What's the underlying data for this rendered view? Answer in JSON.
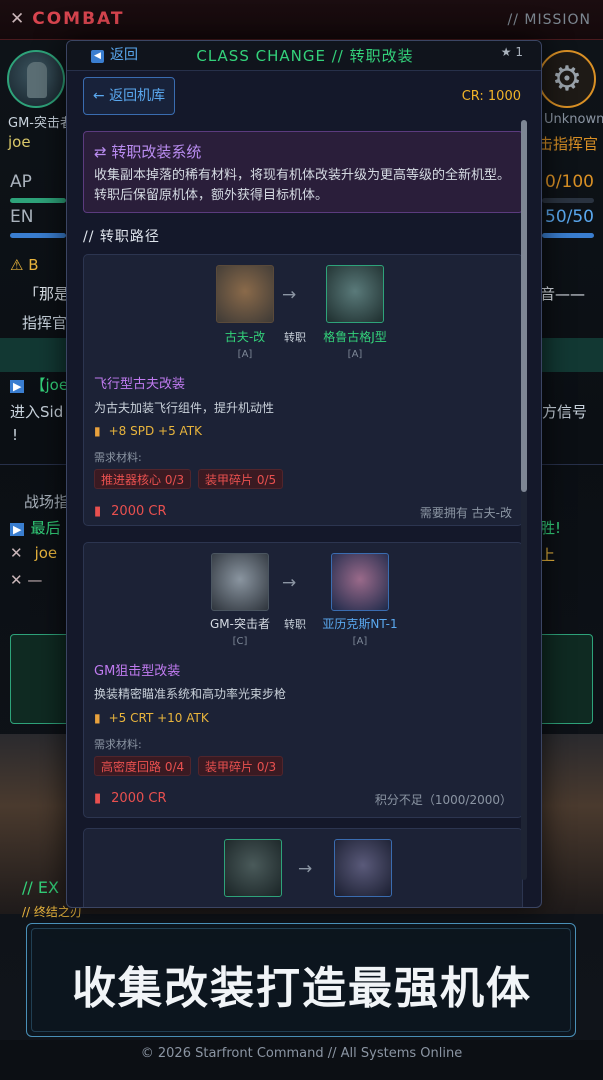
{
  "background": {
    "topbar_title": "COMBAT",
    "topbar_mission": "// MISSION",
    "left_unit": "GM-突击者",
    "left_user": "joe",
    "right_unit": "Unknown",
    "right_user": "击指挥官",
    "ap_label": "AP",
    "ap_value": "0/100",
    "en_label": "EN",
    "en_value": "50/50",
    "log_bracket": "「那是",
    "log_sound": "音——",
    "log_commander": "指挥官",
    "log_joe": "【joe",
    "log_enter": "进入Sid",
    "log_signal": "方信号",
    "log_excl": "!",
    "log_field": "战场指",
    "log_last": "最后",
    "log_victory": "胜!",
    "log_joe2": "joe",
    "log_up": "上",
    "bottom_label": "// EX",
    "bottom_sub": "// 终结之刃"
  },
  "modal": {
    "back_link": "返回",
    "title": "CLASS CHANGE // 转职改装",
    "star": "★ 1",
    "back_button": "← 返回机库",
    "cr": "CR: 1000",
    "info_title": "⇄ 转职改装系统",
    "info_desc": "收集副本掉落的稀有材料，将现有机体改装升级为更高等级的全新机型。转职后保留原机体，额外获得目标机体。",
    "path_heading": "// 转职路径",
    "cards": [
      {
        "from_name": "古夫-改",
        "from_rank": "[A]",
        "to_name": "格鲁古格J型",
        "to_rank": "[A]",
        "change": "转职",
        "title": "飞行型古夫改装",
        "desc": "为古夫加装飞行组件，提升机动性",
        "stats": "+8 SPD  +5 ATK",
        "mat_label": "需求材料:",
        "materials": [
          "推进器核心 0/3",
          "装甲碎片 0/5"
        ],
        "cost": "2000 CR",
        "requirement": "需要拥有 古夫-改"
      },
      {
        "from_name": "GM-突击者",
        "from_rank": "[C]",
        "to_name": "亚历克斯NT-1",
        "to_rank": "[A]",
        "change": "转职",
        "title": "GM狙击型改装",
        "desc": "换装精密瞄准系统和高功率光束步枪",
        "stats": "+5 CRT  +10 ATK",
        "mat_label": "需求材料:",
        "materials": [
          "高密度回路 0/4",
          "装甲碎片 0/3"
        ],
        "cost": "2000 CR",
        "requirement": "积分不足（1000/2000）"
      }
    ]
  },
  "banner": "收集改装打造最强机体",
  "footer": "© 2026 Starfront Command // All Systems Online",
  "colors": {
    "accent_green": "#33d17a",
    "accent_purple": "#c07bf0",
    "accent_red": "#e8504f",
    "accent_gold": "#f0b429",
    "accent_blue": "#5aa8ef"
  }
}
